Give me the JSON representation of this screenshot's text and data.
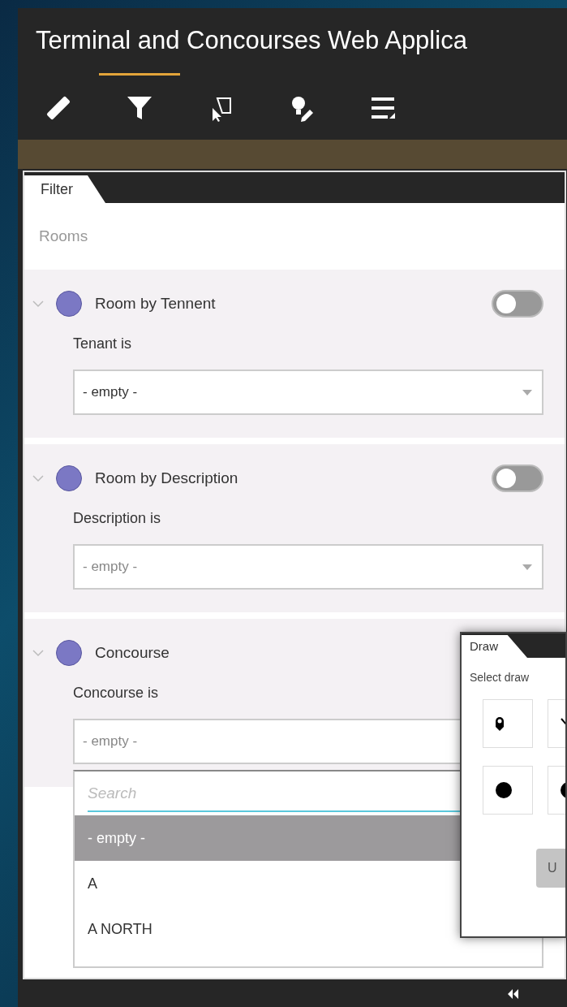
{
  "window": {
    "title": "Terminal and Concourses Web Applica"
  },
  "toolbar": {
    "items": [
      {
        "kind": "ruler",
        "selected": false
      },
      {
        "kind": "filter",
        "selected": true
      },
      {
        "kind": "select",
        "selected": false
      },
      {
        "kind": "bulb",
        "selected": false
      },
      {
        "kind": "list",
        "selected": false
      }
    ]
  },
  "filter_panel": {
    "tab": "Filter",
    "layer": "Rooms",
    "filters": [
      {
        "title": "Room by Tennent",
        "expanded": true,
        "on": false,
        "label": "Tenant is",
        "value": "- empty -",
        "muted": false
      },
      {
        "title": "Room by Description",
        "expanded": true,
        "on": false,
        "label": "Description is",
        "value": "- empty -",
        "muted": true
      },
      {
        "title": "Concourse",
        "expanded": true,
        "label": "Concourse is",
        "value": "- empty -",
        "muted": true,
        "dropdown": {
          "placeholder": "Search",
          "options": [
            {
              "label": "- empty -",
              "selected": true
            },
            {
              "label": "A",
              "selected": false
            },
            {
              "label": "A NORTH",
              "selected": false
            }
          ]
        }
      }
    ]
  },
  "draw_panel": {
    "tab": "Draw",
    "prompt": "Select draw",
    "tools": [
      {
        "kind": "pin"
      },
      {
        "kind": "line"
      },
      {
        "kind": "dot"
      },
      {
        "kind": "dot"
      }
    ],
    "button": {
      "label": "U",
      "disabled": true
    }
  }
}
